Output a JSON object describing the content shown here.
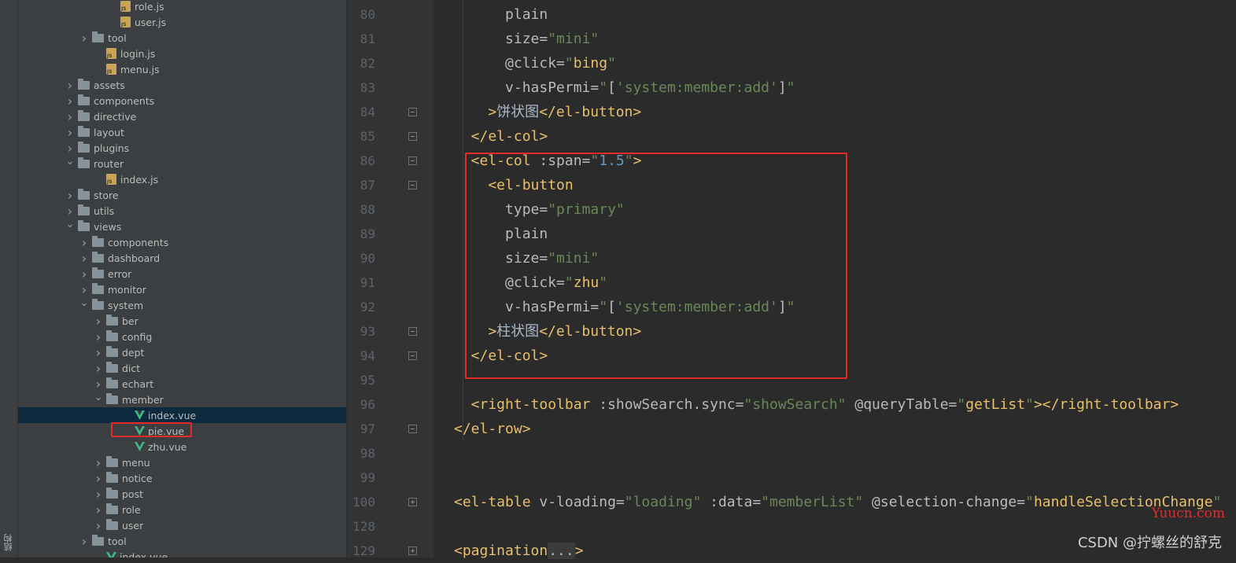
{
  "left_strip": {
    "label": "结构"
  },
  "tree": {
    "rows": [
      {
        "label": "role.js",
        "type": "js",
        "indent": 6,
        "arrow": "none"
      },
      {
        "label": "user.js",
        "type": "js",
        "indent": 6,
        "arrow": "none"
      },
      {
        "label": "tool",
        "type": "folder",
        "indent": 4,
        "arrow": "collapsed"
      },
      {
        "label": "login.js",
        "type": "js",
        "indent": 5,
        "arrow": "none"
      },
      {
        "label": "menu.js",
        "type": "js",
        "indent": 5,
        "arrow": "none"
      },
      {
        "label": "assets",
        "type": "folder",
        "indent": 3,
        "arrow": "collapsed"
      },
      {
        "label": "components",
        "type": "folder",
        "indent": 3,
        "arrow": "collapsed"
      },
      {
        "label": "directive",
        "type": "folder",
        "indent": 3,
        "arrow": "collapsed"
      },
      {
        "label": "layout",
        "type": "folder",
        "indent": 3,
        "arrow": "collapsed"
      },
      {
        "label": "plugins",
        "type": "folder",
        "indent": 3,
        "arrow": "collapsed"
      },
      {
        "label": "router",
        "type": "folder",
        "indent": 3,
        "arrow": "expanded"
      },
      {
        "label": "index.js",
        "type": "js",
        "indent": 5,
        "arrow": "none"
      },
      {
        "label": "store",
        "type": "folder",
        "indent": 3,
        "arrow": "collapsed"
      },
      {
        "label": "utils",
        "type": "folder",
        "indent": 3,
        "arrow": "collapsed"
      },
      {
        "label": "views",
        "type": "folder",
        "indent": 3,
        "arrow": "expanded"
      },
      {
        "label": "components",
        "type": "folder",
        "indent": 4,
        "arrow": "collapsed"
      },
      {
        "label": "dashboard",
        "type": "folder",
        "indent": 4,
        "arrow": "collapsed"
      },
      {
        "label": "error",
        "type": "folder",
        "indent": 4,
        "arrow": "collapsed"
      },
      {
        "label": "monitor",
        "type": "folder",
        "indent": 4,
        "arrow": "collapsed"
      },
      {
        "label": "system",
        "type": "folder",
        "indent": 4,
        "arrow": "expanded"
      },
      {
        "label": "ber",
        "type": "folder",
        "indent": 5,
        "arrow": "collapsed"
      },
      {
        "label": "config",
        "type": "folder",
        "indent": 5,
        "arrow": "collapsed"
      },
      {
        "label": "dept",
        "type": "folder",
        "indent": 5,
        "arrow": "collapsed"
      },
      {
        "label": "dict",
        "type": "folder",
        "indent": 5,
        "arrow": "collapsed"
      },
      {
        "label": "echart",
        "type": "folder",
        "indent": 5,
        "arrow": "collapsed"
      },
      {
        "label": "member",
        "type": "folder",
        "indent": 5,
        "arrow": "expanded"
      },
      {
        "label": "index.vue",
        "type": "vue",
        "indent": 7,
        "arrow": "none",
        "selected": true
      },
      {
        "label": "pie.vue",
        "type": "vue",
        "indent": 7,
        "arrow": "none"
      },
      {
        "label": "zhu.vue",
        "type": "vue",
        "indent": 7,
        "arrow": "none"
      },
      {
        "label": "menu",
        "type": "folder",
        "indent": 5,
        "arrow": "collapsed"
      },
      {
        "label": "notice",
        "type": "folder",
        "indent": 5,
        "arrow": "collapsed"
      },
      {
        "label": "post",
        "type": "folder",
        "indent": 5,
        "arrow": "collapsed"
      },
      {
        "label": "role",
        "type": "folder",
        "indent": 5,
        "arrow": "collapsed"
      },
      {
        "label": "user",
        "type": "folder",
        "indent": 5,
        "arrow": "collapsed"
      },
      {
        "label": "tool",
        "type": "folder",
        "indent": 4,
        "arrow": "collapsed"
      },
      {
        "label": "index.vue",
        "type": "vue",
        "indent": 5,
        "arrow": "none"
      }
    ]
  },
  "editor": {
    "lines": [
      {
        "n": "80",
        "tokens": [
          [
            "attr",
            "      plain"
          ]
        ]
      },
      {
        "n": "81",
        "tokens": [
          [
            "attr",
            "      size="
          ],
          [
            "str",
            "\"mini\""
          ]
        ]
      },
      {
        "n": "82",
        "tokens": [
          [
            "attr",
            "      @click="
          ],
          [
            "str",
            "\""
          ],
          [
            "tag",
            "bing"
          ],
          [
            "str",
            "\""
          ]
        ]
      },
      {
        "n": "83",
        "tokens": [
          [
            "attr",
            "      v-hasPermi="
          ],
          [
            "str",
            "\""
          ],
          [
            "attr",
            "["
          ],
          [
            "str",
            "'system:member:add'"
          ],
          [
            "attr",
            "]"
          ],
          [
            "str",
            "\""
          ]
        ]
      },
      {
        "n": "84",
        "tokens": [
          [
            "tag",
            "    >"
          ],
          [
            "cn",
            "饼状图"
          ],
          [
            "tag",
            "</el-button>"
          ]
        ]
      },
      {
        "n": "85",
        "tokens": [
          [
            "tag",
            "  </el-col>"
          ]
        ]
      },
      {
        "n": "86",
        "tokens": [
          [
            "tag",
            "  <el-col "
          ],
          [
            "attr",
            ":span="
          ],
          [
            "str",
            "\""
          ],
          [
            "num",
            "1.5"
          ],
          [
            "str",
            "\""
          ],
          [
            "tag",
            ">"
          ]
        ]
      },
      {
        "n": "87",
        "tokens": [
          [
            "tag",
            "    <el-button"
          ]
        ]
      },
      {
        "n": "88",
        "tokens": [
          [
            "attr",
            "      type="
          ],
          [
            "str",
            "\"primary\""
          ]
        ]
      },
      {
        "n": "89",
        "tokens": [
          [
            "attr",
            "      plain"
          ]
        ]
      },
      {
        "n": "90",
        "tokens": [
          [
            "attr",
            "      size="
          ],
          [
            "str",
            "\"mini\""
          ]
        ]
      },
      {
        "n": "91",
        "tokens": [
          [
            "attr",
            "      @click="
          ],
          [
            "str",
            "\""
          ],
          [
            "tag",
            "zhu"
          ],
          [
            "str",
            "\""
          ]
        ]
      },
      {
        "n": "92",
        "tokens": [
          [
            "attr",
            "      v-hasPermi="
          ],
          [
            "str",
            "\""
          ],
          [
            "attr",
            "["
          ],
          [
            "str",
            "'system:member:add'"
          ],
          [
            "attr",
            "]"
          ],
          [
            "str",
            "\""
          ]
        ]
      },
      {
        "n": "93",
        "tokens": [
          [
            "tag",
            "    >"
          ],
          [
            "cn",
            "柱状图"
          ],
          [
            "tag",
            "</el-button>"
          ]
        ]
      },
      {
        "n": "94",
        "tokens": [
          [
            "tag",
            "  </el-col>"
          ]
        ]
      },
      {
        "n": "95",
        "tokens": []
      },
      {
        "n": "96",
        "tokens": [
          [
            "tag",
            "  <right-toolbar "
          ],
          [
            "attr",
            ":showSearch.sync="
          ],
          [
            "str",
            "\"showSearch\""
          ],
          [
            "attr",
            " @queryTable="
          ],
          [
            "str",
            "\""
          ],
          [
            "tag",
            "getList"
          ],
          [
            "str",
            "\""
          ],
          [
            "tag",
            "></right-toolbar>"
          ]
        ]
      },
      {
        "n": "97",
        "tokens": [
          [
            "tag",
            "</el-row>"
          ]
        ]
      },
      {
        "n": "98",
        "tokens": []
      },
      {
        "n": "99",
        "tokens": []
      },
      {
        "n": "100",
        "tokens": [
          [
            "tag",
            "<el-table "
          ],
          [
            "attr",
            "v-loading="
          ],
          [
            "str",
            "\"loading\""
          ],
          [
            "attr",
            " :data="
          ],
          [
            "str",
            "\"memberList\""
          ],
          [
            "attr",
            " @selection-change="
          ],
          [
            "str",
            "\""
          ],
          [
            "tag",
            "handleSelectionChange"
          ],
          [
            "str",
            "\""
          ]
        ]
      },
      {
        "n": "128",
        "tokens": []
      },
      {
        "n": "129",
        "tokens": [
          [
            "tag",
            "<pagination"
          ],
          [
            "ellipsis",
            "..."
          ],
          [
            "tag",
            ">"
          ]
        ]
      }
    ]
  },
  "watermark": {
    "site": "Yuucn.com",
    "author": "CSDN @拧螺丝的舒克"
  }
}
